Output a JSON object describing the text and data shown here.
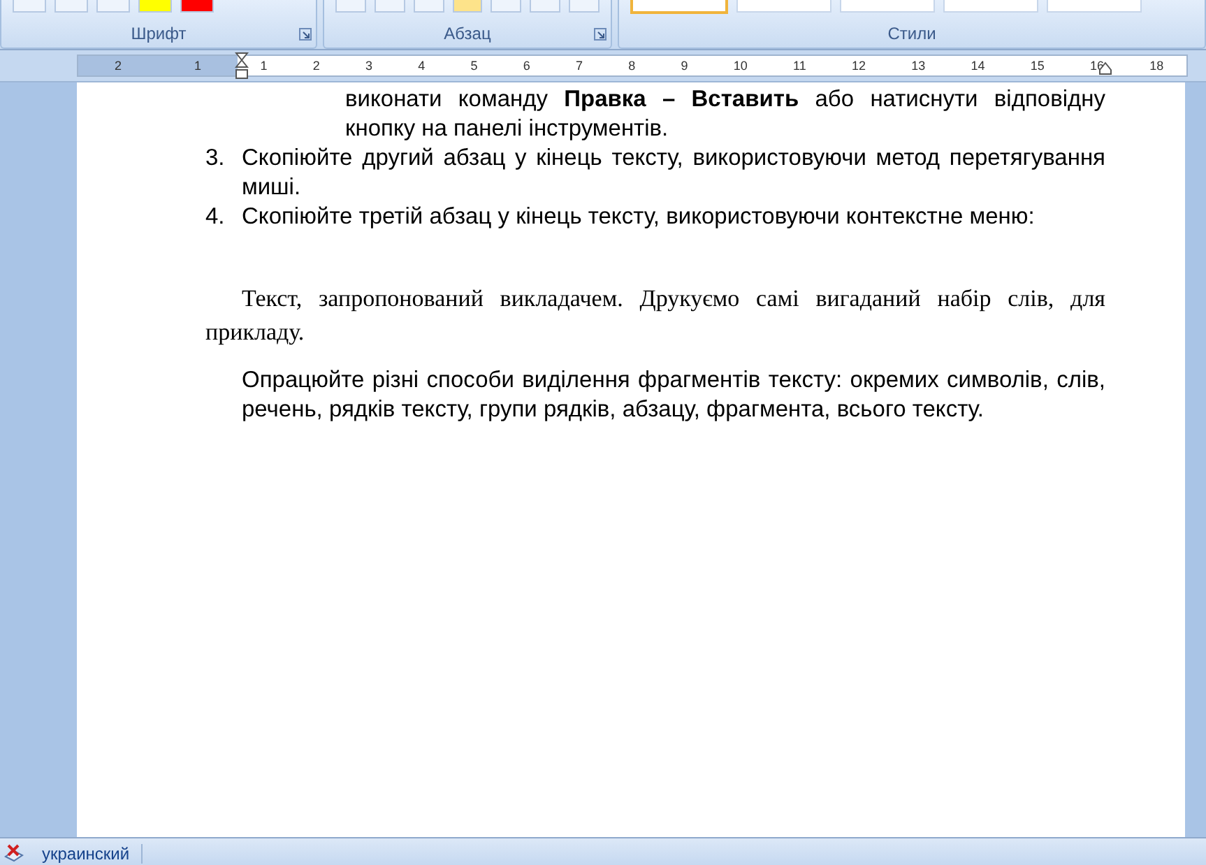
{
  "ribbon": {
    "groups": [
      {
        "label": "Шрифт",
        "launcher": true
      },
      {
        "label": "Абзац",
        "launcher": true
      },
      {
        "label": "Стили",
        "launcher": false
      }
    ]
  },
  "ruler": {
    "labels": [
      "2",
      "1",
      "1",
      "2",
      "3",
      "4",
      "5",
      "6",
      "7",
      "8",
      "9",
      "10",
      "11",
      "12",
      "13",
      "14",
      "15",
      "16",
      "18"
    ]
  },
  "document": {
    "blocks": [
      {
        "kind": "continuation",
        "text": "виконати команду **Правка – Вставить** або натиснути відповідну кнопку на панелі інструментів."
      },
      {
        "kind": "numbered",
        "number": "3.",
        "text": "Скопіюйте другий абзац у кінець тексту, використовуючи метод перетягування миші."
      },
      {
        "kind": "numbered",
        "number": "4.",
        "text": "Скопіюйте третій абзац у кінець тексту, використовуючи контекстне меню:"
      },
      {
        "kind": "serif",
        "text": "Текст, запропонований викладачем. Друкуємо самі вигаданий набір слів, для прикладу."
      },
      {
        "kind": "indented",
        "text": "Опрацюйте різні способи виділення фрагментів тексту: окремих символів, слів, речень, рядків тексту, групи рядків, абзацу, фрагмента, всього тексту."
      }
    ]
  },
  "status_bar": {
    "language": "украинский"
  }
}
